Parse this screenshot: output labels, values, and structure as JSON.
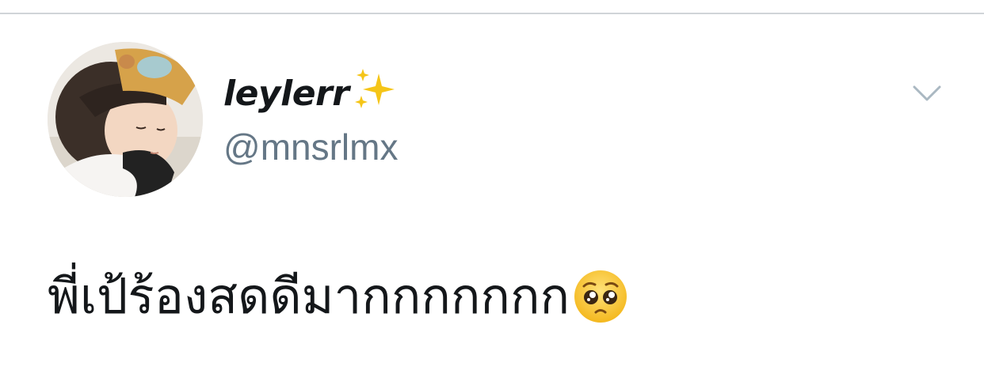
{
  "tweet": {
    "author": {
      "display_name": "leylerr",
      "name_emoji": "sparkles-icon",
      "handle": "@mnsrlmx",
      "avatar": "avatar-photo"
    },
    "text": "พี่เป้ร้องสดดีมากกกกกกก",
    "text_emoji": "pleading-face-icon",
    "menu_icon": "chevron-down-icon"
  },
  "colors": {
    "text_primary": "#14171a",
    "text_secondary": "#657786",
    "divider": "#d0d4d8",
    "caret": "#aab8c2",
    "sparkle": "#f5c518"
  }
}
